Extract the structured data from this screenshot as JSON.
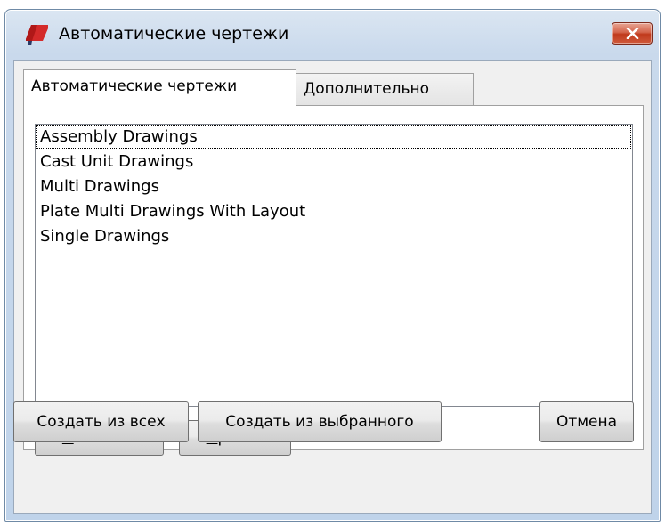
{
  "window": {
    "title": "Автоматические чертежи",
    "app_icon": "tekla-logo-icon",
    "close_icon": "close-icon",
    "close_button_color": "#c0391c"
  },
  "tabs": [
    {
      "label": "Автоматические чертежи",
      "active": true
    },
    {
      "label": "Дополнительно",
      "active": false
    }
  ],
  "list": {
    "items": [
      "Assembly Drawings",
      "Cast Unit Drawings",
      "Multi Drawings",
      "Plate Multi Drawings With Layout",
      "Single Drawings"
    ],
    "focused_index": 0
  },
  "panel_buttons": {
    "show": {
      "accel": "П",
      "rest": "оказать"
    },
    "edit": {
      "accel": "П",
      "rest": "равка"
    }
  },
  "footer_buttons": {
    "create_all": "Создать из всех",
    "create_selected": "Создать из выбранного",
    "cancel": "Отмена"
  }
}
